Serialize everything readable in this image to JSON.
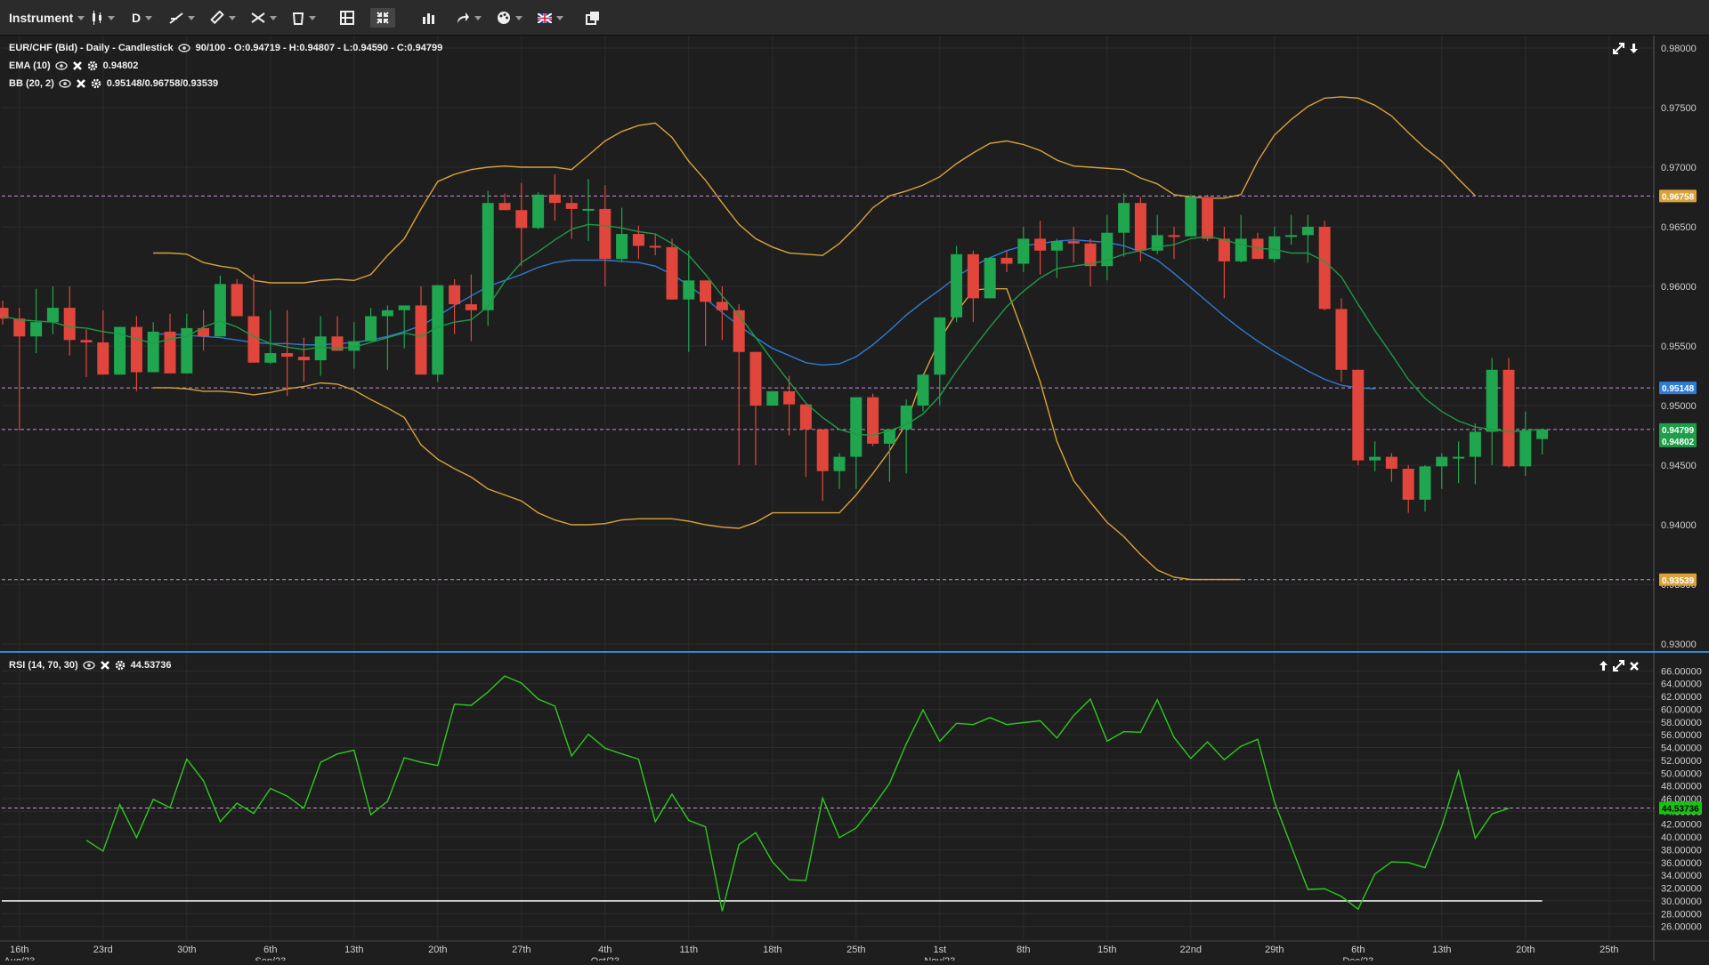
{
  "toolbar": {
    "instrument_label": "Instrument",
    "period_label": "D",
    "items": [
      "candle-type-icon",
      "line-tool-icon",
      "ruler-icon",
      "drawing-icon",
      "trash-icon",
      "layout-icon",
      "fullscreen-icon",
      "bar-chart-icon",
      "share-icon",
      "palette-icon",
      "flag-icon",
      "popout-icon"
    ]
  },
  "price_panel": {
    "legend_main": "EUR/CHF (Bid) - Daily - Candlestick",
    "legend_ohlc": "90/100 - O:0.94719 - H:0.94807 - L:0.94590 - C:0.94799",
    "ema_label": "EMA (10)",
    "ema_value": "0.94802",
    "bb_label": "BB (20, 2)",
    "bb_value": "0.95148/0.96758/0.93539",
    "badges": [
      {
        "text": "0.96758",
        "color": "#d9a23a",
        "value": 0.96758
      },
      {
        "text": "0.95148",
        "color": "#2e7bd6",
        "value": 0.95148
      },
      {
        "text": "0.94799",
        "color": "#1e9e48",
        "value": 0.94799
      },
      {
        "text": "0.94802",
        "color": "#1e9e48",
        "value": 0.94702
      },
      {
        "text": "0.93539",
        "color": "#d9a23a",
        "value": 0.93539
      }
    ]
  },
  "rsi_panel": {
    "legend_label": "RSI (14, 70, 30)",
    "legend_value": "44.53736",
    "badge": {
      "text": "44.53736",
      "color": "#16c40f",
      "value": 44.53736
    }
  },
  "x_axis": {
    "labels": [
      {
        "day": "16th",
        "month": "Aug/23",
        "x": 1
      },
      {
        "day": "23rd",
        "x": 6
      },
      {
        "day": "30th",
        "x": 11
      },
      {
        "day": "6th",
        "month": "Sep/23",
        "x": 16
      },
      {
        "day": "13th",
        "x": 21
      },
      {
        "day": "20th",
        "x": 26
      },
      {
        "day": "27th",
        "x": 31
      },
      {
        "day": "4th",
        "month": "Oct/23",
        "x": 36
      },
      {
        "day": "11th",
        "x": 41
      },
      {
        "day": "18th",
        "x": 46
      },
      {
        "day": "25th",
        "x": 51
      },
      {
        "day": "1st",
        "month": "Nov/23",
        "x": 56
      },
      {
        "day": "8th",
        "x": 61
      },
      {
        "day": "15th",
        "x": 66
      },
      {
        "day": "22nd",
        "x": 71
      },
      {
        "day": "29th",
        "x": 76
      },
      {
        "day": "6th",
        "month": "Dec/23",
        "x": 81
      },
      {
        "day": "13th",
        "x": 86
      },
      {
        "day": "20th",
        "x": 91
      },
      {
        "day": "25th",
        "x": 96
      }
    ]
  },
  "colors": {
    "bull": "#1fa64f",
    "bear": "#e0463b",
    "ema": "#1f9a47",
    "bb_band": "#d9a23a",
    "bb_mid": "#2e7bd6",
    "rsi": "#2ec81f",
    "grid": "#2c2c2c"
  },
  "chart_data": [
    {
      "type": "candlestick",
      "title": "EUR/CHF (Bid) - Daily - Candlestick",
      "ylim": [
        0.93,
        0.98
      ],
      "yticks": [
        "0.93000",
        "0.93500",
        "0.94000",
        "0.94500",
        "0.95000",
        "0.95500",
        "0.96000",
        "0.96500",
        "0.97000",
        "0.97500",
        "0.98000"
      ],
      "horizontal_lines": [
        0.96758,
        0.95148,
        0.94799,
        0.93539
      ],
      "candles": [
        [
          0.9582,
          0.9588,
          0.9568,
          0.9573
        ],
        [
          0.9573,
          0.9582,
          0.9479,
          0.9558
        ],
        [
          0.9558,
          0.9598,
          0.9544,
          0.957
        ],
        [
          0.957,
          0.96,
          0.956,
          0.9582
        ],
        [
          0.9582,
          0.96,
          0.9542,
          0.9555
        ],
        [
          0.9555,
          0.9564,
          0.9524,
          0.9553
        ],
        [
          0.9553,
          0.958,
          0.9528,
          0.9526
        ],
        [
          0.9526,
          0.9565,
          0.9527,
          0.9566
        ],
        [
          0.9566,
          0.9575,
          0.9512,
          0.9528
        ],
        [
          0.9528,
          0.957,
          0.9532,
          0.9562
        ],
        [
          0.9562,
          0.9577,
          0.953,
          0.9527
        ],
        [
          0.9527,
          0.9577,
          0.9552,
          0.9565
        ],
        [
          0.9565,
          0.958,
          0.9546,
          0.9558
        ],
        [
          0.9558,
          0.9609,
          0.9558,
          0.9602
        ],
        [
          0.9602,
          0.9606,
          0.958,
          0.9575
        ],
        [
          0.9575,
          0.961,
          0.9552,
          0.9536
        ],
        [
          0.9536,
          0.958,
          0.9535,
          0.9544
        ],
        [
          0.9544,
          0.958,
          0.9508,
          0.9541
        ],
        [
          0.9541,
          0.9557,
          0.952,
          0.9538
        ],
        [
          0.9538,
          0.9575,
          0.9525,
          0.9558
        ],
        [
          0.9558,
          0.9575,
          0.955,
          0.9546
        ],
        [
          0.9546,
          0.957,
          0.9531,
          0.9554
        ],
        [
          0.9554,
          0.9582,
          0.9555,
          0.9575
        ],
        [
          0.9575,
          0.9584,
          0.953,
          0.958
        ],
        [
          0.958,
          0.9584,
          0.9548,
          0.9584
        ],
        [
          0.9584,
          0.96,
          0.9542,
          0.9526
        ],
        [
          0.9526,
          0.96,
          0.952,
          0.9601
        ],
        [
          0.9601,
          0.9606,
          0.956,
          0.9585
        ],
        [
          0.9585,
          0.961,
          0.9554,
          0.958
        ],
        [
          0.958,
          0.968,
          0.9567,
          0.967
        ],
        [
          0.967,
          0.9678,
          0.967,
          0.9664
        ],
        [
          0.9664,
          0.9687,
          0.9617,
          0.9649
        ],
        [
          0.9649,
          0.9679,
          0.9648,
          0.9677
        ],
        [
          0.9677,
          0.9694,
          0.9655,
          0.967
        ],
        [
          0.967,
          0.9675,
          0.964,
          0.9665
        ],
        [
          0.9665,
          0.969,
          0.9638,
          0.9665
        ],
        [
          0.9665,
          0.9685,
          0.96,
          0.9623
        ],
        [
          0.9623,
          0.9666,
          0.962,
          0.9644
        ],
        [
          0.9644,
          0.9651,
          0.9623,
          0.9634
        ],
        [
          0.9634,
          0.9644,
          0.9626,
          0.9633
        ],
        [
          0.9633,
          0.964,
          0.959,
          0.9589
        ],
        [
          0.9589,
          0.963,
          0.9545,
          0.9605
        ],
        [
          0.9605,
          0.96,
          0.955,
          0.9587
        ],
        [
          0.9587,
          0.96,
          0.9555,
          0.958
        ],
        [
          0.958,
          0.9585,
          0.945,
          0.9545
        ],
        [
          0.9545,
          0.95,
          0.945,
          0.95
        ],
        [
          0.95,
          0.949,
          0.95,
          0.9512
        ],
        [
          0.9512,
          0.9525,
          0.9475,
          0.9501
        ],
        [
          0.9501,
          0.949,
          0.944,
          0.948
        ],
        [
          0.948,
          0.947,
          0.942,
          0.9445
        ],
        [
          0.9445,
          0.946,
          0.943,
          0.9457
        ],
        [
          0.9457,
          0.9507,
          0.943,
          0.9507
        ],
        [
          0.9507,
          0.951,
          0.9466,
          0.9468
        ],
        [
          0.9468,
          0.948,
          0.9436,
          0.948
        ],
        [
          0.948,
          0.9505,
          0.9443,
          0.95
        ],
        [
          0.95,
          0.952,
          0.9495,
          0.9526
        ],
        [
          0.9526,
          0.955,
          0.95,
          0.9574
        ],
        [
          0.9574,
          0.9634,
          0.957,
          0.9627
        ],
        [
          0.9627,
          0.963,
          0.957,
          0.959
        ],
        [
          0.959,
          0.962,
          0.959,
          0.9624
        ],
        [
          0.9624,
          0.963,
          0.9612,
          0.9619
        ],
        [
          0.9619,
          0.965,
          0.9612,
          0.964
        ],
        [
          0.964,
          0.9655,
          0.961,
          0.963
        ],
        [
          0.963,
          0.964,
          0.9607,
          0.9638
        ],
        [
          0.9638,
          0.965,
          0.962,
          0.9636
        ],
        [
          0.9636,
          0.964,
          0.96,
          0.9617
        ],
        [
          0.9617,
          0.966,
          0.9605,
          0.9645
        ],
        [
          0.9645,
          0.9678,
          0.9625,
          0.967
        ],
        [
          0.967,
          0.9675,
          0.9621,
          0.963
        ],
        [
          0.963,
          0.966,
          0.9627,
          0.9643
        ],
        [
          0.9643,
          0.965,
          0.9623,
          0.9642
        ],
        [
          0.9642,
          0.9677,
          0.9645,
          0.9675
        ],
        [
          0.9675,
          0.9677,
          0.9638,
          0.964
        ],
        [
          0.964,
          0.965,
          0.959,
          0.9621
        ],
        [
          0.9621,
          0.966,
          0.962,
          0.964
        ],
        [
          0.964,
          0.9645,
          0.9625,
          0.9623
        ],
        [
          0.9623,
          0.965,
          0.962,
          0.9642
        ],
        [
          0.9642,
          0.966,
          0.9635,
          0.9643
        ],
        [
          0.9643,
          0.966,
          0.962,
          0.965
        ],
        [
          0.965,
          0.9655,
          0.958,
          0.9581
        ],
        [
          0.9581,
          0.959,
          0.952,
          0.953
        ],
        [
          0.953,
          0.952,
          0.945,
          0.9454
        ],
        [
          0.9454,
          0.947,
          0.9445,
          0.9457
        ],
        [
          0.9457,
          0.946,
          0.9436,
          0.9447
        ],
        [
          0.9447,
          0.945,
          0.941,
          0.9421
        ],
        [
          0.9421,
          0.945,
          0.9411,
          0.9449
        ],
        [
          0.9449,
          0.946,
          0.943,
          0.9457
        ],
        [
          0.9457,
          0.947,
          0.9435,
          0.9457
        ],
        [
          0.9457,
          0.9485,
          0.9434,
          0.9478
        ],
        [
          0.9478,
          0.954,
          0.945,
          0.953
        ],
        [
          0.953,
          0.954,
          0.9448,
          0.9449
        ],
        [
          0.9449,
          0.9495,
          0.9441,
          0.9479
        ],
        [
          0.94719,
          0.94807,
          0.9459,
          0.94799
        ]
      ],
      "ema_10": [
        0.9575,
        0.9572,
        0.9571,
        0.957,
        0.9566,
        0.9565,
        0.9562,
        0.956,
        0.9556,
        0.9552,
        0.9556,
        0.9558,
        0.9566,
        0.9571,
        0.9566,
        0.9558,
        0.9552,
        0.9549,
        0.9547,
        0.9549,
        0.9548,
        0.9549,
        0.9553,
        0.9557,
        0.9561,
        0.9558,
        0.9566,
        0.957,
        0.9572,
        0.9583,
        0.9604,
        0.962,
        0.9629,
        0.9639,
        0.9648,
        0.9652,
        0.9651,
        0.9649,
        0.9646,
        0.9644,
        0.9636,
        0.9626,
        0.961,
        0.9592,
        0.9576,
        0.9557,
        0.9538,
        0.952,
        0.9502,
        0.949,
        0.948,
        0.9476,
        0.9475,
        0.9479,
        0.9484,
        0.9493,
        0.9508,
        0.9529,
        0.9548,
        0.9566,
        0.9583,
        0.9596,
        0.9607,
        0.9615,
        0.9617,
        0.9619,
        0.9622,
        0.9627,
        0.963,
        0.9633,
        0.9635,
        0.964,
        0.9642,
        0.9639,
        0.9635,
        0.9632,
        0.9631,
        0.9628,
        0.9628,
        0.9621,
        0.9608,
        0.9585,
        0.9563,
        0.9543,
        0.9522,
        0.9506,
        0.9495,
        0.9487,
        0.9482,
        0.948,
        0.9478,
        0.9479,
        0.948
      ],
      "bb_upper": [
        null,
        null,
        null,
        null,
        null,
        null,
        null,
        null,
        null,
        0.9628,
        0.9628,
        0.9627,
        0.962,
        0.9617,
        0.9615,
        0.9605,
        0.9603,
        0.9603,
        0.9603,
        0.9605,
        0.9606,
        0.9605,
        0.961,
        0.9626,
        0.964,
        0.9665,
        0.9688,
        0.9694,
        0.9698,
        0.97,
        0.9701,
        0.97,
        0.97,
        0.97,
        0.9698,
        0.971,
        0.9722,
        0.973,
        0.9735,
        0.9737,
        0.9725,
        0.9705,
        0.9689,
        0.967,
        0.9652,
        0.964,
        0.9633,
        0.9628,
        0.9627,
        0.9626,
        0.9636,
        0.965,
        0.9666,
        0.9676,
        0.968,
        0.9685,
        0.9692,
        0.9703,
        0.9712,
        0.972,
        0.9722,
        0.9719,
        0.9714,
        0.9706,
        0.9701,
        0.97,
        0.9699,
        0.9698,
        0.9691,
        0.9686,
        0.9677,
        0.9675,
        0.9674,
        0.9674,
        0.9677,
        0.9705,
        0.9727,
        0.974,
        0.9751,
        0.9758,
        0.9759,
        0.9758,
        0.9752,
        0.9743,
        0.9729,
        0.9716,
        0.9705,
        0.969,
        0.9676,
        null,
        null,
        null,
        null
      ],
      "bb_mid": [
        null,
        null,
        null,
        null,
        null,
        null,
        null,
        null,
        null,
        0.956,
        0.956,
        0.9559,
        0.9558,
        0.9557,
        0.9555,
        0.9553,
        0.9552,
        0.9552,
        0.9551,
        0.9551,
        0.9552,
        0.9553,
        0.9555,
        0.9558,
        0.9562,
        0.9567,
        0.9575,
        0.9584,
        0.9592,
        0.96,
        0.9605,
        0.961,
        0.9616,
        0.962,
        0.9622,
        0.9622,
        0.9622,
        0.9621,
        0.962,
        0.9617,
        0.961,
        0.9601,
        0.959,
        0.9578,
        0.9567,
        0.9557,
        0.9548,
        0.9542,
        0.9536,
        0.9534,
        0.9535,
        0.9541,
        0.9551,
        0.9563,
        0.9576,
        0.9587,
        0.9597,
        0.9608,
        0.9617,
        0.9624,
        0.963,
        0.9634,
        0.9636,
        0.9638,
        0.9639,
        0.9638,
        0.9637,
        0.9634,
        0.9629,
        0.9622,
        0.9611,
        0.9599,
        0.9587,
        0.9575,
        0.9564,
        0.9554,
        0.9545,
        0.9537,
        0.9529,
        0.9522,
        0.9517,
        0.9515,
        0.9514,
        null,
        null,
        null,
        null,
        null,
        null,
        null,
        null,
        null,
        null
      ],
      "bb_lower": [
        null,
        null,
        null,
        null,
        null,
        null,
        null,
        null,
        null,
        0.9515,
        0.9515,
        0.9514,
        0.9512,
        0.9512,
        0.9511,
        0.9509,
        0.9511,
        0.9514,
        0.9516,
        0.9519,
        0.9518,
        0.9513,
        0.9505,
        0.9498,
        0.949,
        0.9467,
        0.9455,
        0.9447,
        0.944,
        0.943,
        0.9425,
        0.942,
        0.941,
        0.9404,
        0.94,
        0.94,
        0.9401,
        0.9404,
        0.9405,
        0.9405,
        0.9405,
        0.9403,
        0.94,
        0.9398,
        0.9397,
        0.9402,
        0.941,
        0.941,
        0.941,
        0.941,
        0.941,
        0.9425,
        0.9443,
        0.9462,
        0.9485,
        0.9525,
        0.9555,
        0.9578,
        0.9597,
        0.9598,
        0.9598,
        0.956,
        0.952,
        0.947,
        0.9437,
        0.9419,
        0.9402,
        0.939,
        0.9375,
        0.9362,
        0.9356,
        0.9354,
        0.9354,
        0.9354,
        0.9354,
        null,
        null,
        null,
        null,
        null,
        null,
        null,
        null,
        null,
        null,
        null,
        null,
        null,
        null,
        null,
        null,
        null,
        null
      ]
    },
    {
      "type": "line",
      "title": "RSI (14, 70, 30)",
      "ylim": [
        24,
        68
      ],
      "yticks": [
        "26.00000",
        "28.00000",
        "30.00000",
        "32.00000",
        "34.00000",
        "36.00000",
        "38.00000",
        "40.00000",
        "42.00000",
        "44.00000",
        "46.00000",
        "48.00000",
        "50.00000",
        "52.00000",
        "54.00000",
        "56.00000",
        "58.00000",
        "60.00000",
        "62.00000",
        "64.00000",
        "66.00000"
      ],
      "horizontal_lines": [
        30,
        44.53736
      ],
      "x_start": 5,
      "series": [
        {
          "values": [
            39.5,
            37.8,
            45.1,
            39.9,
            45.9,
            44.6,
            52.2,
            48.8,
            42.4,
            45.3,
            43.7,
            47.6,
            46.4,
            44.5,
            51.7,
            53.0,
            53.6,
            43.5,
            45.6,
            52.4,
            51.7,
            51.2,
            60.8,
            60.6,
            62.7,
            65.2,
            64.1,
            61.6,
            60.5,
            52.7,
            56.1,
            53.9,
            53.0,
            52.2,
            42.4,
            46.7,
            42.6,
            41.6,
            28.4,
            38.8,
            40.7,
            36.1,
            33.3,
            33.2,
            46.1,
            39.9,
            41.4,
            44.7,
            48.4,
            54.6,
            59.9,
            55.0,
            57.8,
            57.6,
            58.7,
            57.6,
            57.9,
            58.2,
            55.5,
            59.0,
            61.6,
            55.0,
            56.5,
            56.4,
            61.5,
            55.6,
            52.3,
            54.9,
            52.1,
            54.2,
            55.3,
            45.5,
            38.6,
            31.8,
            31.9,
            30.7,
            28.7,
            34.2,
            36.1,
            36.0,
            35.2,
            41.7,
            50.3,
            39.8,
            43.6,
            44.5
          ]
        }
      ]
    }
  ]
}
